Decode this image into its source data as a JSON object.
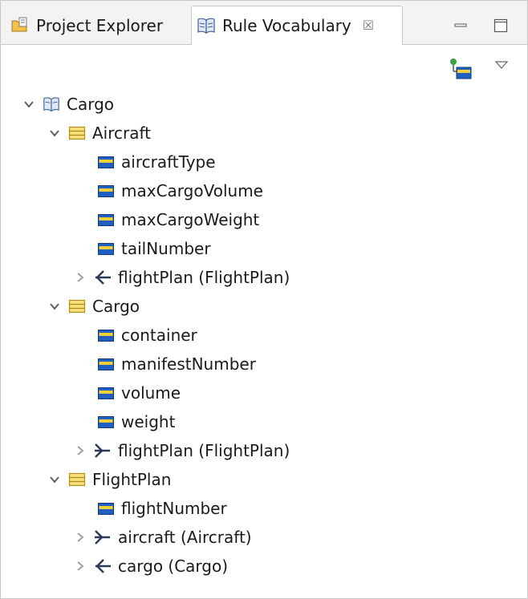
{
  "tabs": [
    {
      "label": "Project Explorer"
    },
    {
      "label": "Rule Vocabulary"
    }
  ],
  "tab_close_glyph": "☒",
  "tree": {
    "root": {
      "label": "Cargo"
    },
    "items": [
      {
        "label": "Aircraft"
      },
      {
        "label": "aircraftType"
      },
      {
        "label": "maxCargoVolume"
      },
      {
        "label": "maxCargoWeight"
      },
      {
        "label": "tailNumber"
      },
      {
        "label": "flightPlan (FlightPlan)"
      },
      {
        "label": "Cargo"
      },
      {
        "label": "container"
      },
      {
        "label": "manifestNumber"
      },
      {
        "label": "volume"
      },
      {
        "label": "weight"
      },
      {
        "label": "flightPlan (FlightPlan)"
      },
      {
        "label": "FlightPlan"
      },
      {
        "label": "flightNumber"
      },
      {
        "label": "aircraft (Aircraft)"
      },
      {
        "label": "cargo (Cargo)"
      }
    ]
  },
  "colors": {
    "entity_fill": "#f6e27a",
    "entity_stroke": "#b08c1a",
    "attribute_fill": "#1f5fbf",
    "attribute_band": "#f3cf3a",
    "association": "#2a3a55",
    "twisty": "#606060"
  }
}
